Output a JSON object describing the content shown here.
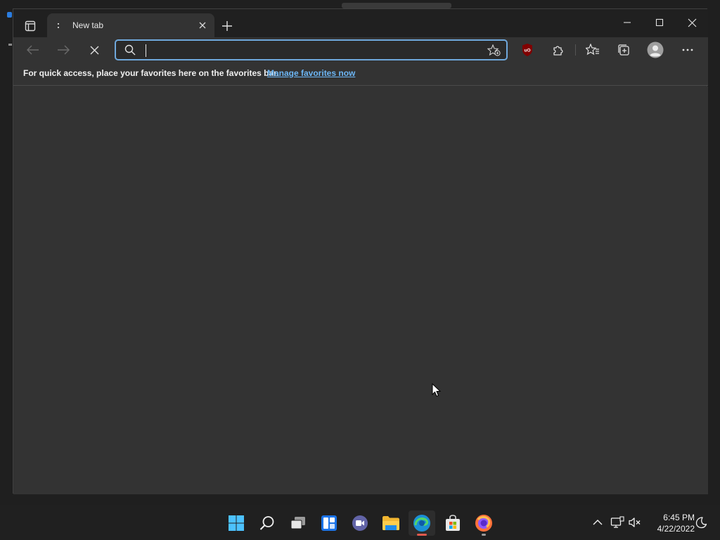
{
  "window": {
    "tab_title": "New tab",
    "tab_favicon": ":",
    "icons": {
      "tab_actions": "tab-actions-icon",
      "tab_close": "close-icon",
      "new_tab": "plus-icon",
      "minimize": "minimize-icon",
      "maximize": "maximize-icon",
      "close": "close-icon"
    }
  },
  "toolbar": {
    "address": {
      "value": "",
      "placeholder": ""
    },
    "icons": [
      "back-icon",
      "forward-icon",
      "stop-icon",
      "search-icon",
      "add-favorite-icon",
      "ublock-icon",
      "extensions-icon",
      "favorites-icon",
      "collections-icon",
      "profile-icon",
      "more-icon"
    ]
  },
  "favorites_bar": {
    "message": "For quick access, place your favorites here on the favorites bar.",
    "link": "Manage favorites now"
  },
  "taskbar": {
    "apps": [
      "start-icon",
      "search-icon",
      "task-view-icon",
      "widgets-icon",
      "chat-icon",
      "file-explorer-icon",
      "edge-icon",
      "store-icon",
      "firefox-icon"
    ],
    "tray": [
      "chevron-up-icon",
      "network-icon",
      "volume-muted-icon",
      "focus-assist-icon"
    ],
    "time": "6:45 PM",
    "date": "4/22/2022"
  },
  "colors": {
    "accent": "#6fa8dc",
    "link": "#6cb6f5",
    "window_bg": "#333333",
    "titlebar_bg": "#202020",
    "ublock_red": "#800000"
  }
}
